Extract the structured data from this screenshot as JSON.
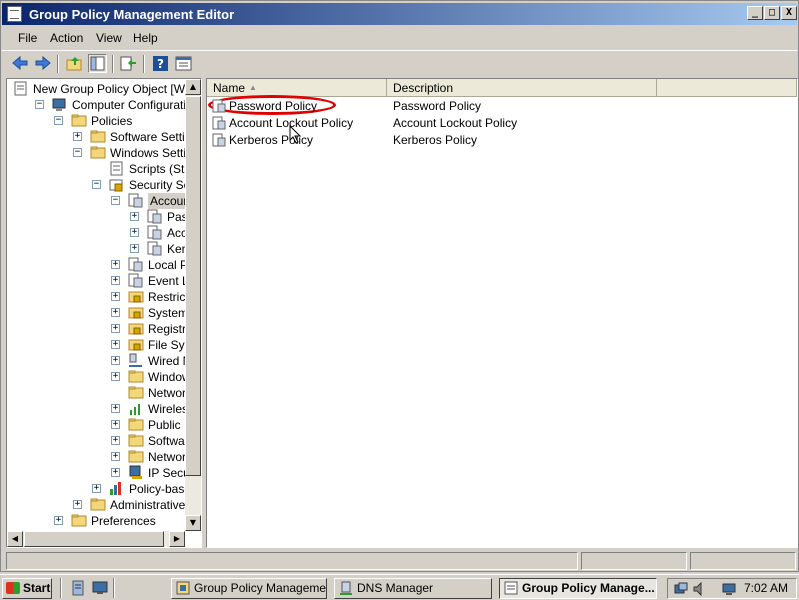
{
  "window": {
    "title": "Group Policy Management Editor",
    "controls": {
      "minimize": "_",
      "maximize": "□",
      "close": "X"
    }
  },
  "menu": [
    "File",
    "Action",
    "View",
    "Help"
  ],
  "toolbar": {
    "icons": [
      "back-icon",
      "forward-icon",
      "up-folder-icon",
      "show-hide-tree-icon",
      "export-list-icon",
      "help-icon",
      "properties-icon"
    ]
  },
  "tree": {
    "items": [
      {
        "label": "New Group Policy Object [WIN-",
        "icon": "gpo-document-icon"
      },
      {
        "label": "Computer Configuration",
        "icon": "computer-icon",
        "exp": "−"
      },
      {
        "label": "Policies",
        "icon": "folder-icon",
        "exp": "−"
      },
      {
        "label": "Software Settings",
        "icon": "folder-icon",
        "exp": "+"
      },
      {
        "label": "Windows Settings",
        "icon": "folder-icon",
        "exp": "−"
      },
      {
        "label": "Scripts (Startup",
        "icon": "scripts-icon"
      },
      {
        "label": "Security Setting",
        "icon": "security-icon",
        "exp": "−"
      },
      {
        "label": "Account Pol",
        "icon": "policy-icon",
        "exp": "−"
      },
      {
        "label": "Passwo",
        "icon": "policy-icon",
        "exp": "+"
      },
      {
        "label": "Accoun",
        "icon": "policy-icon",
        "exp": "+"
      },
      {
        "label": "Kerbero",
        "icon": "policy-icon",
        "exp": "+"
      },
      {
        "label": "Local Policie",
        "icon": "policy-icon",
        "exp": "+"
      },
      {
        "label": "Event Log",
        "icon": "policy-icon",
        "exp": "+"
      },
      {
        "label": "Restricted G",
        "icon": "lock-folder-icon",
        "exp": "+"
      },
      {
        "label": "System Serv",
        "icon": "lock-folder-icon",
        "exp": "+"
      },
      {
        "label": "Registry",
        "icon": "lock-folder-icon",
        "exp": "+"
      },
      {
        "label": "File System",
        "icon": "lock-folder-icon",
        "exp": "+"
      },
      {
        "label": "Wired Netw",
        "icon": "network-icon",
        "exp": "+"
      },
      {
        "label": "Windows Fir",
        "icon": "folder-icon",
        "exp": "+"
      },
      {
        "label": "Network Lis",
        "icon": "folder-icon"
      },
      {
        "label": "Wireless Ne",
        "icon": "wireless-icon",
        "exp": "+"
      },
      {
        "label": "Public Key F",
        "icon": "folder-icon",
        "exp": "+"
      },
      {
        "label": "Software Re",
        "icon": "folder-icon",
        "exp": "+"
      },
      {
        "label": "Network Ac",
        "icon": "folder-icon",
        "exp": "+"
      },
      {
        "label": "IP Security",
        "icon": "ip-security-icon",
        "exp": "+"
      },
      {
        "label": "Policy-based Qo",
        "icon": "chart-icon",
        "exp": "+"
      },
      {
        "label": "Administrative Temp",
        "icon": "folder-icon",
        "exp": "+"
      },
      {
        "label": "Preferences",
        "icon": "folder-icon",
        "exp": "+"
      }
    ]
  },
  "list": {
    "columns": [
      "Name",
      "Description"
    ],
    "rows": [
      {
        "name": "Password Policy",
        "description": "Password Policy"
      },
      {
        "name": "Account Lockout Policy",
        "description": "Account Lockout Policy"
      },
      {
        "name": "Kerberos Policy",
        "description": "Kerberos Policy"
      }
    ]
  },
  "taskbar": {
    "start": "Start",
    "buttons": [
      {
        "label": "Group Policy Management",
        "icon": "gpm-icon"
      },
      {
        "label": "DNS Manager",
        "icon": "dns-icon"
      },
      {
        "label": "Group Policy Manage...",
        "icon": "gpme-icon",
        "active": true
      }
    ],
    "clock": "7:02 AM"
  }
}
